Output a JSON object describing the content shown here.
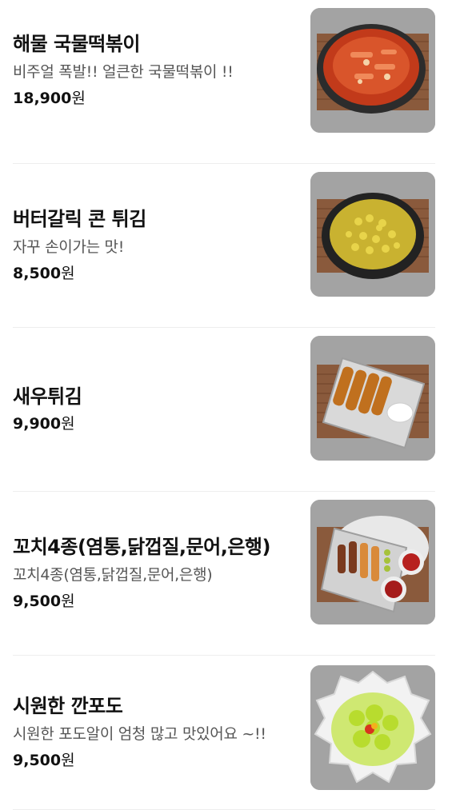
{
  "menu": {
    "items": [
      {
        "name": "해물 국물떡볶이",
        "description": "비주얼 폭발!! 얼큰한 국물떡볶이 !!",
        "price": "18,900",
        "currency": "원",
        "image_icon": "seafood-tteokbokki-icon"
      },
      {
        "name": "버터갈릭 콘 튀김",
        "description": "자꾸 손이가는 맛!",
        "price": "8,500",
        "currency": "원",
        "image_icon": "butter-garlic-corn-icon"
      },
      {
        "name": "새우튀김",
        "description": "",
        "price": "9,900",
        "currency": "원",
        "image_icon": "fried-shrimp-icon"
      },
      {
        "name": "꼬치4종(염통,닭껍질,문어,은행)",
        "description": "꼬치4종(염통,닭껍질,문어,은행)",
        "price": "9,500",
        "currency": "원",
        "image_icon": "skewers-icon"
      },
      {
        "name": "시원한 깐포도",
        "description": "시원한 포도알이 엄청 많고 맛있어요 ~!!",
        "price": "9,500",
        "currency": "원",
        "image_icon": "peeled-grapes-icon"
      }
    ]
  },
  "colors": {
    "name": "#111111",
    "description": "#555555",
    "divider": "#eeeeee",
    "thumb_bg": "#a5a5a5",
    "mat": "#8a5a3c"
  }
}
